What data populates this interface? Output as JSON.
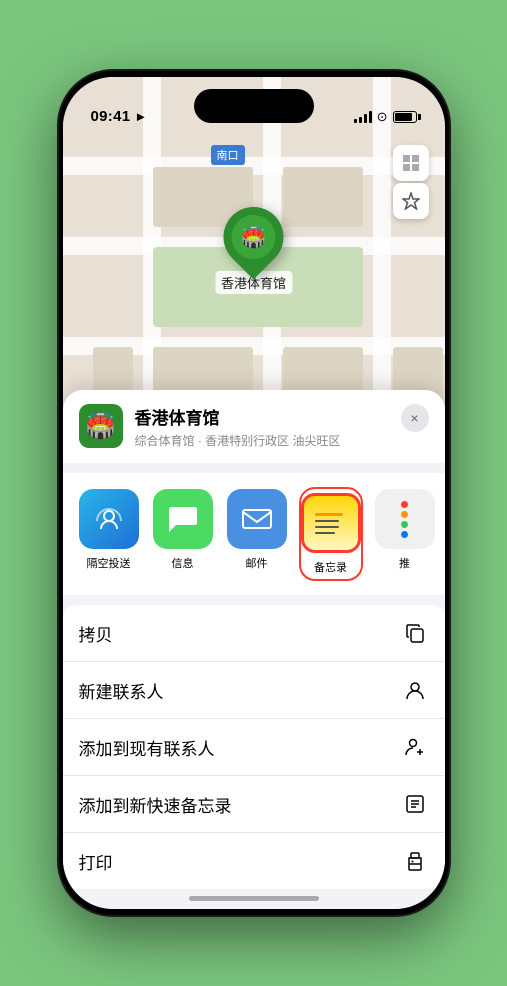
{
  "status_bar": {
    "time": "09:41",
    "location_arrow": "▶"
  },
  "map": {
    "north_label": "南口",
    "location_name": "香港体育馆"
  },
  "place_card": {
    "name": "香港体育馆",
    "description": "综合体育馆 · 香港特别行政区 油尖旺区",
    "close_label": "×"
  },
  "share_items": [
    {
      "id": "airdrop",
      "label": "隔空投送"
    },
    {
      "id": "message",
      "label": "信息"
    },
    {
      "id": "mail",
      "label": "邮件"
    },
    {
      "id": "notes",
      "label": "备忘录"
    },
    {
      "id": "more",
      "label": "推"
    }
  ],
  "actions": [
    {
      "label": "拷贝",
      "icon": "copy"
    },
    {
      "label": "新建联系人",
      "icon": "person"
    },
    {
      "label": "添加到现有联系人",
      "icon": "person-add"
    },
    {
      "label": "添加到新快速备忘录",
      "icon": "memo"
    },
    {
      "label": "打印",
      "icon": "print"
    }
  ]
}
